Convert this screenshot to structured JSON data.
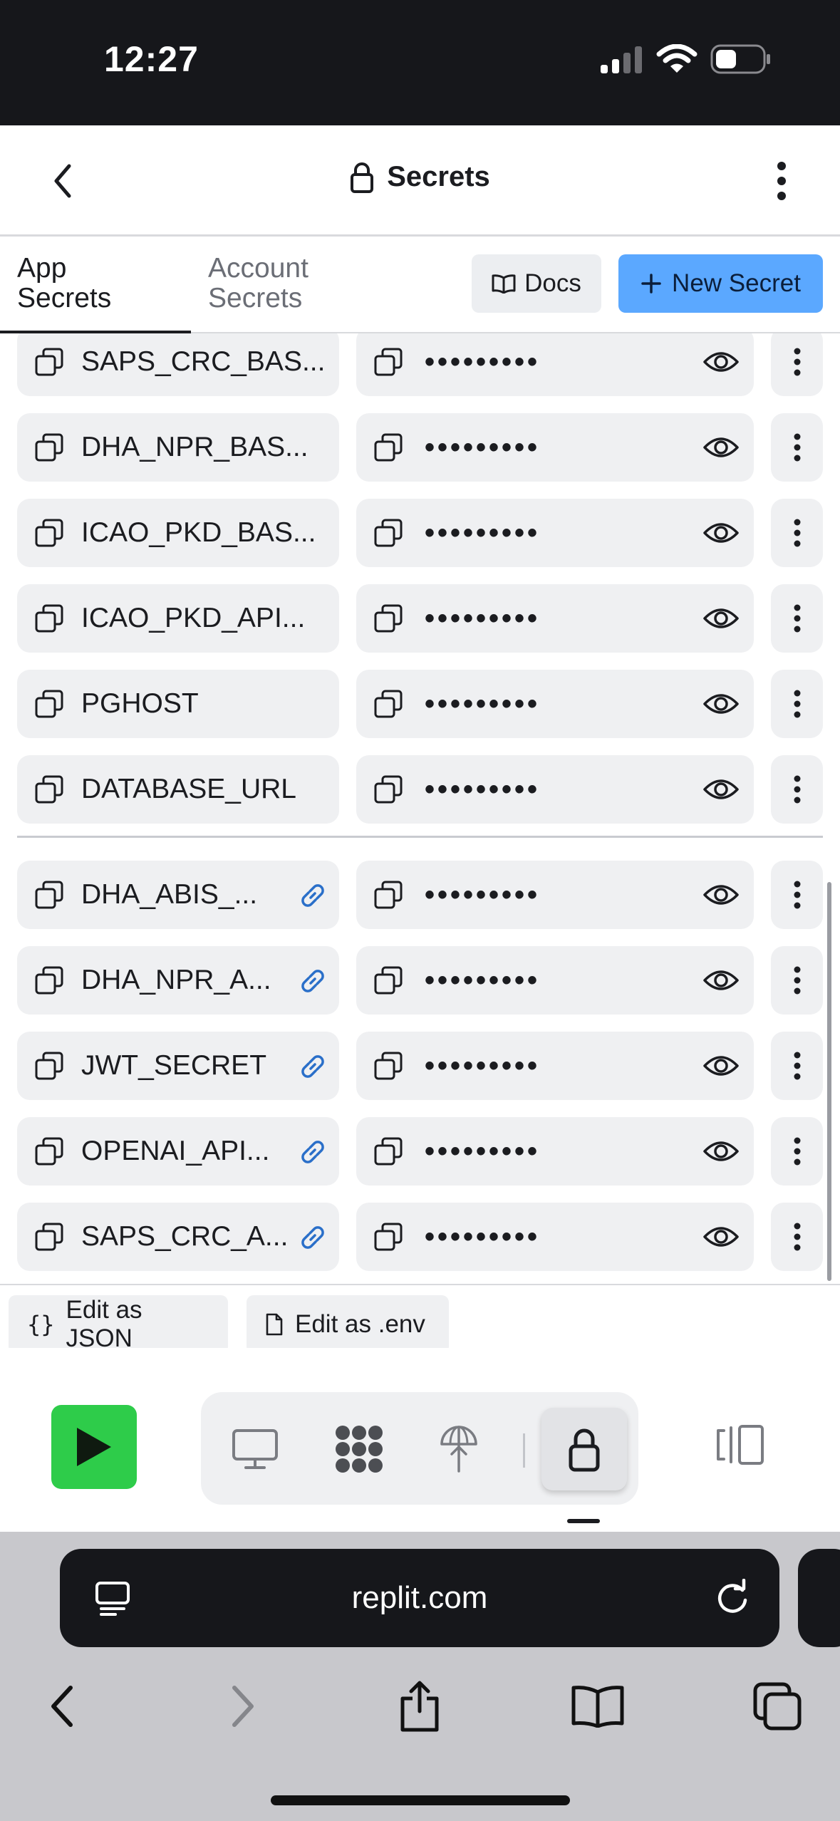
{
  "status_bar": {
    "time": "12:27"
  },
  "header": {
    "title": "Secrets"
  },
  "tabs": [
    {
      "line1": "App",
      "line2": "Secrets",
      "active": true
    },
    {
      "line1": "Account",
      "line2": "Secrets",
      "active": false
    }
  ],
  "actions": {
    "docs_label": "Docs",
    "new_secret_label": "New Secret"
  },
  "secrets": [
    {
      "key": "SAPS_CRC_BAS...",
      "value": "•••••••••",
      "linked": false
    },
    {
      "key": "DHA_NPR_BAS...",
      "value": "•••••••••",
      "linked": false
    },
    {
      "key": "ICAO_PKD_BAS...",
      "value": "•••••••••",
      "linked": false
    },
    {
      "key": "ICAO_PKD_API...",
      "value": "•••••••••",
      "linked": false
    },
    {
      "key": "PGHOST",
      "value": "•••••••••",
      "linked": false
    },
    {
      "key": "DATABASE_URL",
      "value": "•••••••••",
      "linked": false
    },
    {
      "key": "DHA_ABIS_...",
      "value": "•••••••••",
      "linked": true
    },
    {
      "key": "DHA_NPR_A...",
      "value": "•••••••••",
      "linked": true
    },
    {
      "key": "JWT_SECRET",
      "value": "•••••••••",
      "linked": true
    },
    {
      "key": "OPENAI_API...",
      "value": "•••••••••",
      "linked": true
    },
    {
      "key": "SAPS_CRC_A...",
      "value": "•••••••••",
      "linked": true
    }
  ],
  "edit": {
    "json_label": "Edit as JSON",
    "env_label": "Edit as .env"
  },
  "toolbar": {
    "tools": [
      "monitor-icon",
      "workflows-icon",
      "deployments-icon",
      "lock-icon"
    ],
    "active_tool": "lock-icon"
  },
  "browser": {
    "url": "replit.com"
  },
  "colors": {
    "accent": "#5ba8ff",
    "run": "#2ecc4a",
    "link": "#2a6fc9",
    "cell_bg": "#eff0f2"
  }
}
